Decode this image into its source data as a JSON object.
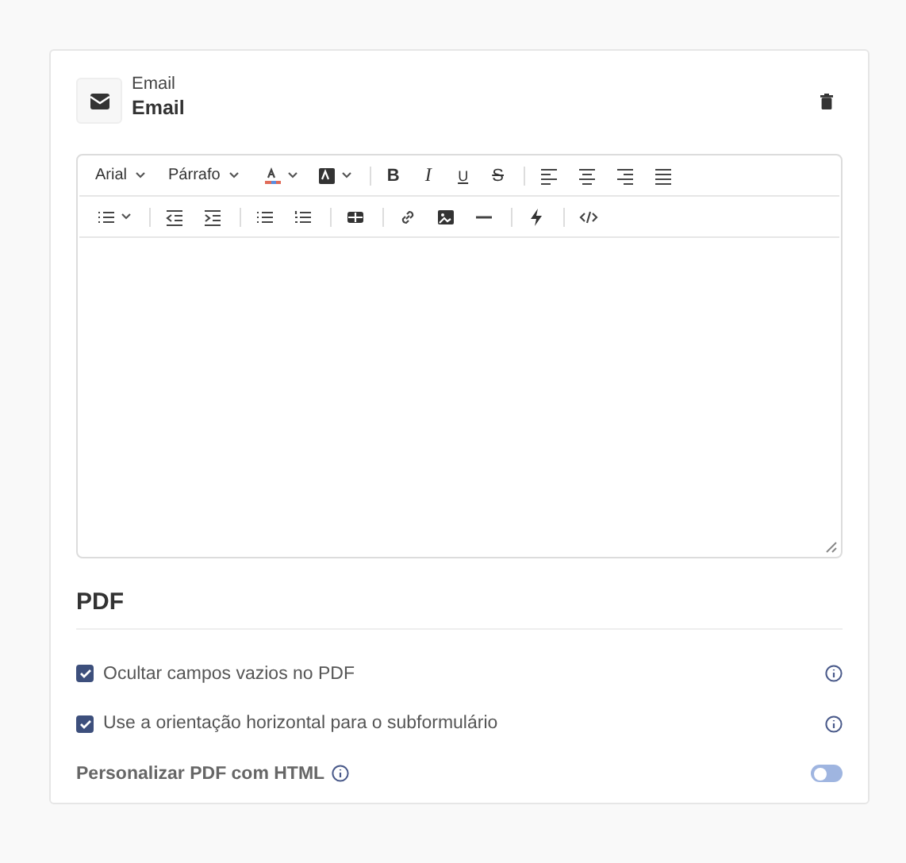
{
  "header": {
    "caption": "Email",
    "title": "Email"
  },
  "toolbar": [
    [
      {
        "kind": "dropdown",
        "label": "Arial"
      },
      {
        "kind": "dropdown",
        "label": "Párrafo"
      },
      {
        "kind": "font-color"
      },
      {
        "kind": "bg-color"
      },
      {
        "kind": "sep"
      },
      {
        "kind": "bold",
        "label": "B"
      },
      {
        "kind": "italic",
        "label": "I"
      },
      {
        "kind": "underline",
        "label": "U"
      },
      {
        "kind": "strike",
        "label": "S"
      },
      {
        "kind": "sep"
      },
      {
        "kind": "align-left"
      },
      {
        "kind": "align-center"
      },
      {
        "kind": "align-right"
      },
      {
        "kind": "justify"
      }
    ],
    [
      {
        "kind": "list-menu"
      },
      {
        "kind": "sep"
      },
      {
        "kind": "outdent"
      },
      {
        "kind": "indent"
      },
      {
        "kind": "sep"
      },
      {
        "kind": "bullets"
      },
      {
        "kind": "numbers"
      },
      {
        "kind": "sep"
      },
      {
        "kind": "table"
      },
      {
        "kind": "sep"
      },
      {
        "kind": "link"
      },
      {
        "kind": "image"
      },
      {
        "kind": "rule"
      },
      {
        "kind": "sep"
      },
      {
        "kind": "bolt"
      },
      {
        "kind": "sep"
      },
      {
        "kind": "code"
      }
    ]
  ],
  "pdf": {
    "title": "PDF",
    "options": [
      {
        "label": "Ocultar campos vazios no PDF",
        "checked": true
      },
      {
        "label": "Use a orientação horizontal para o subformulário",
        "checked": true
      }
    ],
    "html_toggle": {
      "label": "Personalizar PDF com HTML",
      "on": false
    }
  }
}
